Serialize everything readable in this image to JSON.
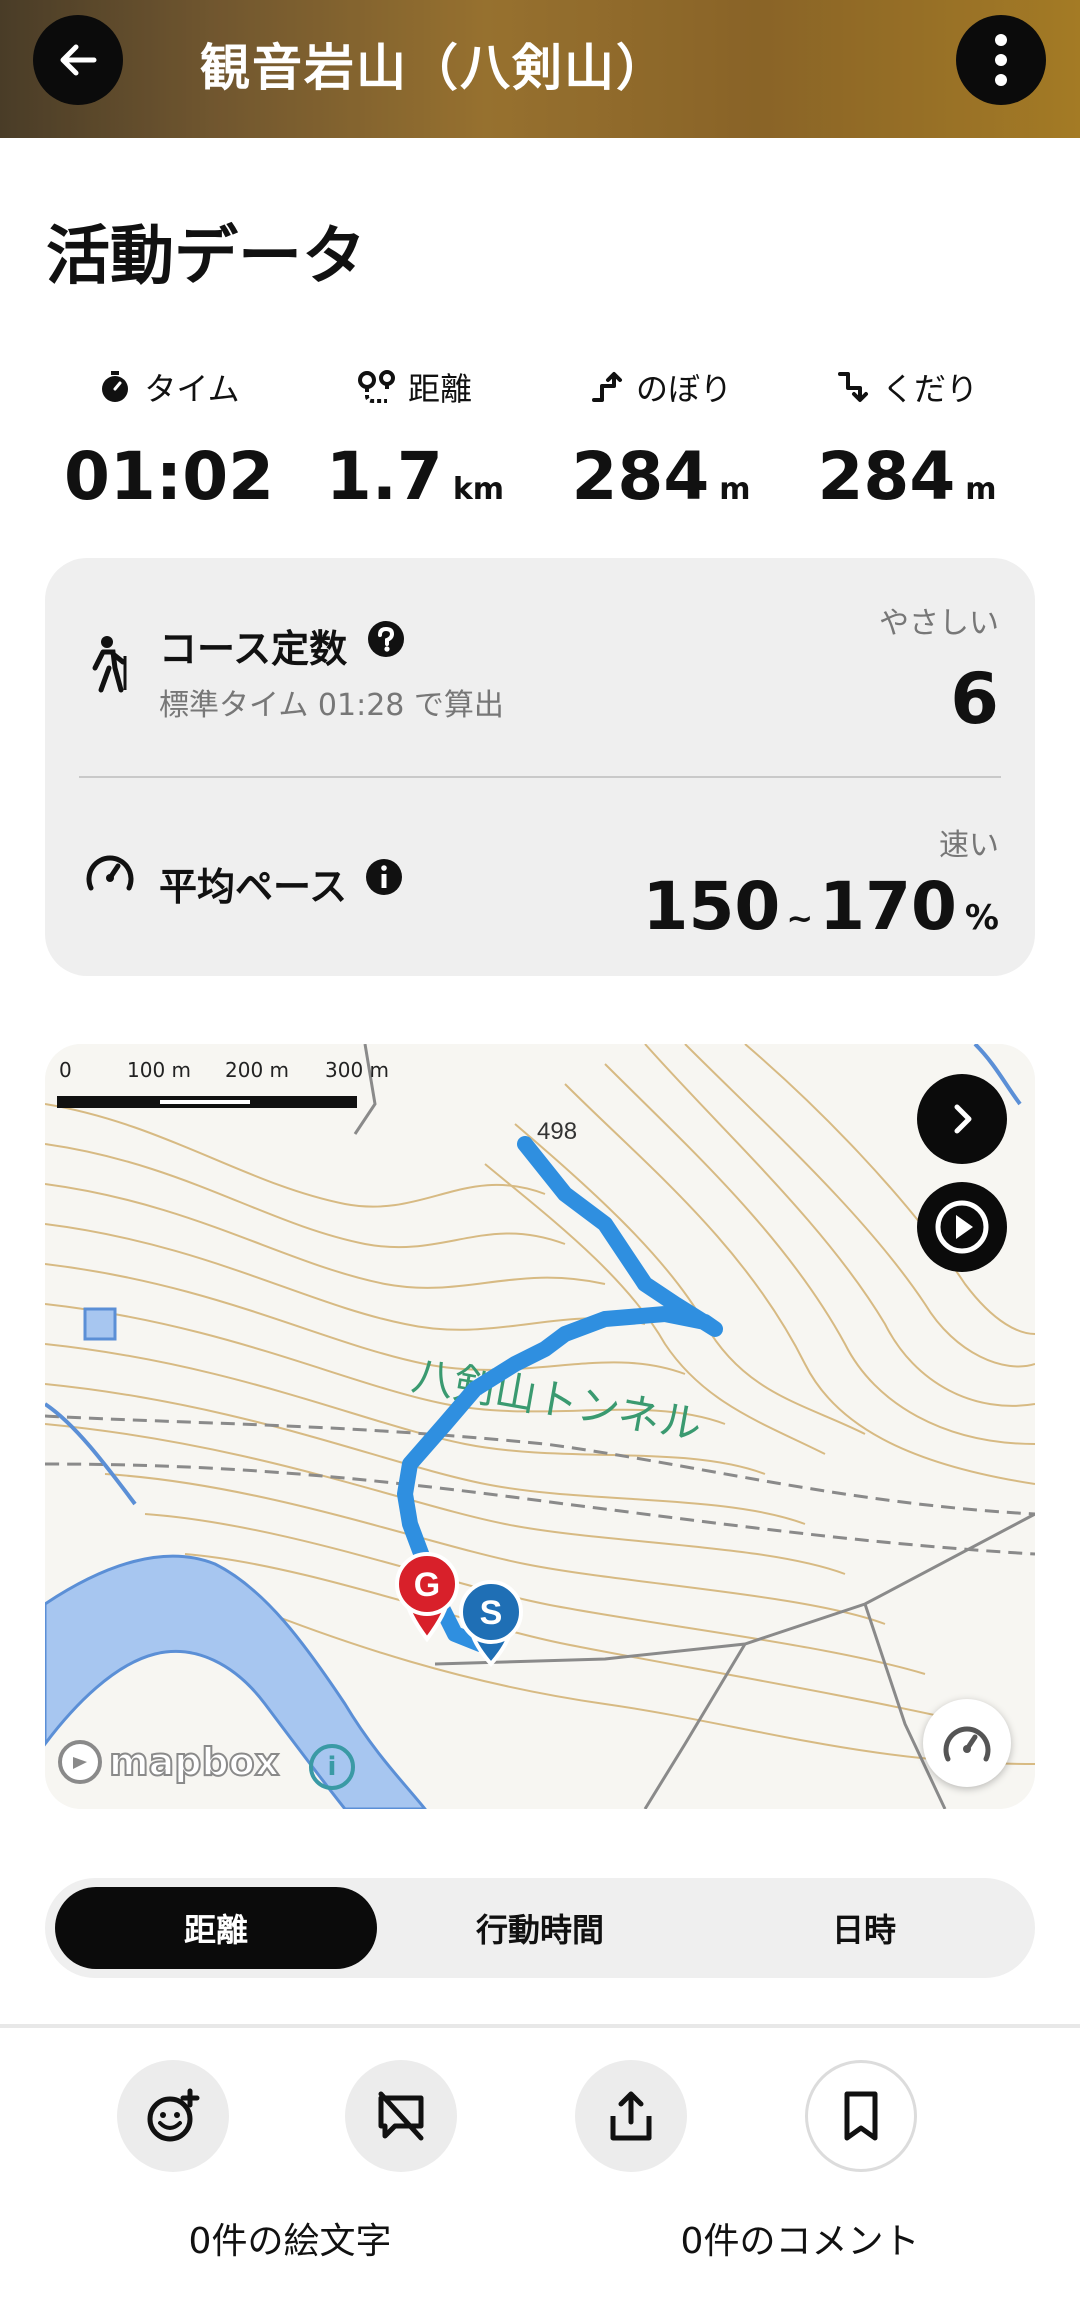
{
  "header": {
    "title": "観音岩山（八剣山）",
    "back_icon": "arrow-left-icon",
    "more_icon": "more-vertical-icon"
  },
  "section_title": "活動データ",
  "stats": [
    {
      "icon": "stopwatch-icon",
      "label": "タイム",
      "value": "01:02",
      "unit": ""
    },
    {
      "icon": "route-pin-icon",
      "label": "距離",
      "value": "1.7",
      "unit": "km"
    },
    {
      "icon": "ascent-icon",
      "label": "のぼり",
      "value": "284",
      "unit": "m"
    },
    {
      "icon": "descent-icon",
      "label": "くだり",
      "value": "284",
      "unit": "m"
    }
  ],
  "course": {
    "title": "コース定数",
    "subtitle": "標準タイム 01:28 で算出",
    "level": "やさしい",
    "value": "6"
  },
  "pace": {
    "title": "平均ペース",
    "level": "速い",
    "min": "150",
    "tilde": "~",
    "max": "170",
    "unit": "%"
  },
  "map": {
    "scale": [
      "0",
      "100 m",
      "200 m",
      "300 m"
    ],
    "elevation_label": "498",
    "place_label": "八剣山トンネル",
    "goal_marker": "G",
    "start_marker": "S",
    "attribution": "mapbox",
    "info_glyph": "i",
    "colors": {
      "route": "#2f8fe0",
      "goal": "#d8202a",
      "start": "#1f6fb5",
      "water": "#a7c6f0"
    }
  },
  "tabs": [
    {
      "label": "距離",
      "active": true
    },
    {
      "label": "行動時間",
      "active": false
    },
    {
      "label": "日時",
      "active": false
    }
  ],
  "actions": {
    "emoji_count_label": "0件の絵文字",
    "comment_count_label": "0件のコメント"
  }
}
